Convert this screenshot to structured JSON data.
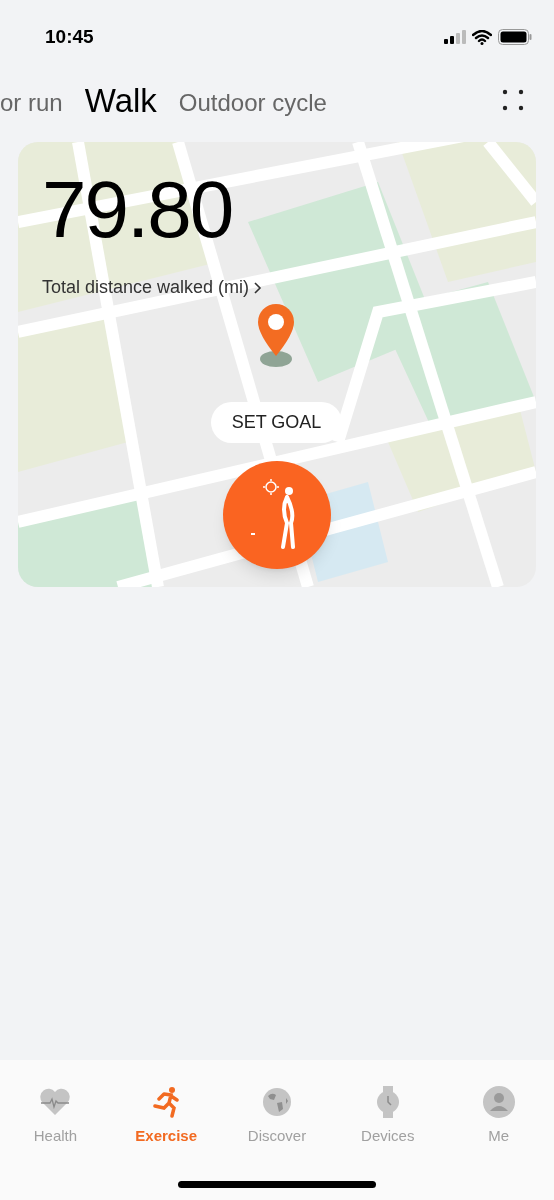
{
  "status_bar": {
    "time": "10:45"
  },
  "tabs": [
    {
      "label": "or run",
      "selected": false
    },
    {
      "label": "Walk",
      "selected": true
    },
    {
      "label": "Outdoor cycle",
      "selected": false
    }
  ],
  "card": {
    "distance": "79.80",
    "distance_label": "Total distance walked (mi)",
    "goal_button": "SET GOAL"
  },
  "bottom_nav": [
    {
      "label": "Health",
      "selected": false
    },
    {
      "label": "Exercise",
      "selected": true
    },
    {
      "label": "Discover",
      "selected": false
    },
    {
      "label": "Devices",
      "selected": false
    },
    {
      "label": "Me",
      "selected": false
    }
  ]
}
